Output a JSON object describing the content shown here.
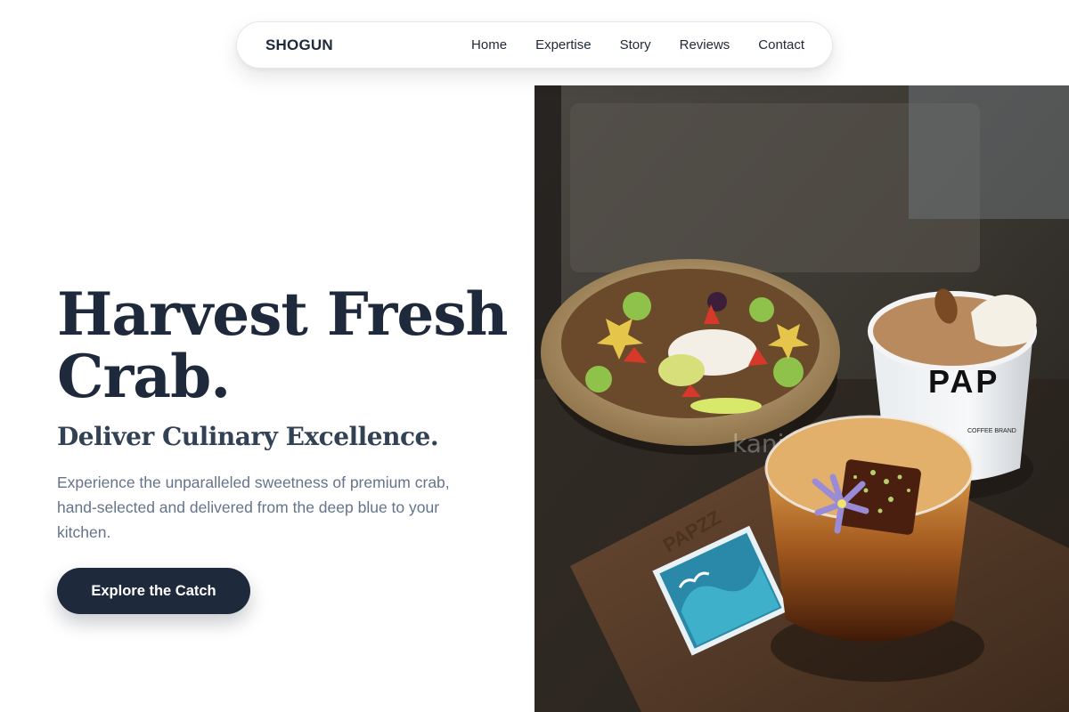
{
  "nav": {
    "brand": "SHOGUN",
    "links": [
      {
        "label": "Home"
      },
      {
        "label": "Expertise"
      },
      {
        "label": "Story"
      },
      {
        "label": "Reviews"
      },
      {
        "label": "Contact"
      }
    ]
  },
  "hero": {
    "title_line1": "Harvest Fresh",
    "title_line2": "Crab.",
    "subtitle": "Deliver Culinary Excellence.",
    "description": "Experience the unparalleled sweetness of premium crab, hand-selected and delivered from the deep blue to your kitchen.",
    "cta_label": "Explore the Catch"
  },
  "photo": {
    "cup_text": "PAP",
    "cup_subtext": "COFFEE BRAND",
    "tray_text": "PAPZZ",
    "watermark": "kani"
  },
  "colors": {
    "ink": "#1e293b",
    "muted": "#64748b",
    "button": "#1e293b"
  }
}
